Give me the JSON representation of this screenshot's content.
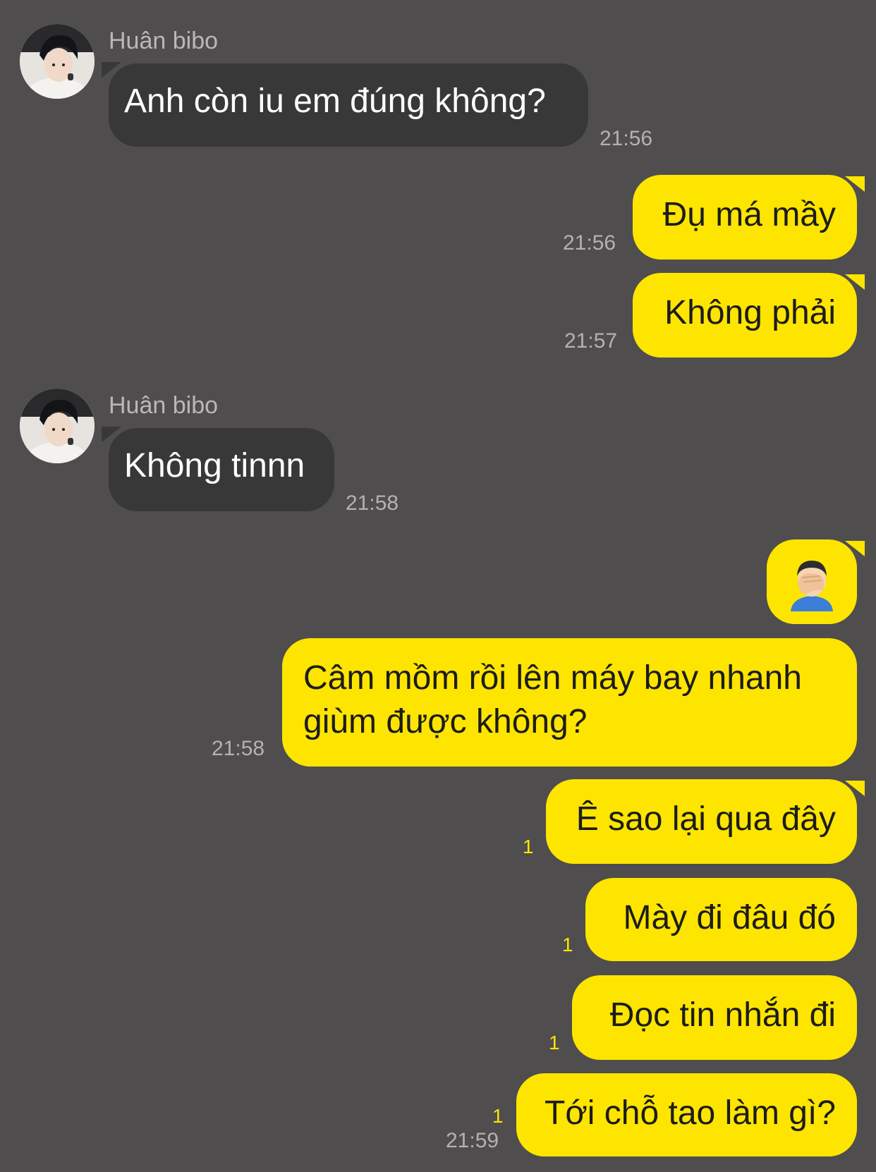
{
  "contact": {
    "name": "Huân bibo"
  },
  "messages": [
    {
      "from": "contact",
      "text": "Anh còn iu em đúng không?",
      "time": "21:56"
    },
    {
      "from": "me",
      "text": "Đụ má mầy",
      "time": "21:56"
    },
    {
      "from": "me",
      "text": "Không phải",
      "time": "21:57"
    },
    {
      "from": "contact",
      "text": "Không tinnn",
      "time": "21:58"
    },
    {
      "from": "me",
      "emoji": "facepalm-man-emoji"
    },
    {
      "from": "me",
      "lines": [
        "Câm mồm rồi lên máy bay nhanh",
        "giùm được không?"
      ],
      "time": "21:58"
    },
    {
      "from": "me",
      "text": "Ê sao lại qua đây",
      "unread": "1"
    },
    {
      "from": "me",
      "text": "Mày đi đâu đó",
      "unread": "1"
    },
    {
      "from": "me",
      "text": "Đọc tin nhắn đi",
      "unread": "1"
    },
    {
      "from": "me",
      "text": "Tới chỗ tao làm gì?",
      "unread": "1",
      "time": "21:59"
    }
  ],
  "colors": {
    "background": "#4f4d4e",
    "incoming_bubble": "#393839",
    "outgoing_bubble": "#fde500",
    "timestamp": "#b3b1b2",
    "unread_count": "#fde500"
  }
}
